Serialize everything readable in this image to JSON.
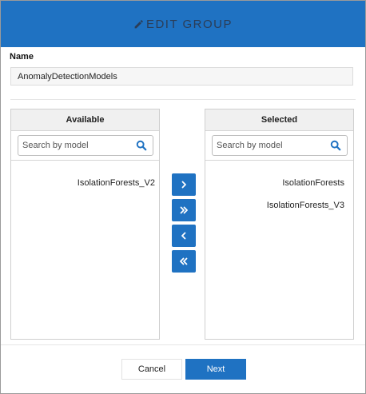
{
  "header": {
    "title": "EDIT GROUP",
    "icon": "pencil-icon",
    "background": "#1f72c2"
  },
  "name": {
    "label": "Name",
    "value": "AnomalyDetectionModels"
  },
  "available": {
    "title": "Available",
    "search_placeholder": "Search by model",
    "items": [
      "IsolationForests_V2"
    ]
  },
  "selected": {
    "title": "Selected",
    "search_placeholder": "Search by model",
    "items": [
      "IsolationForests",
      "IsolationForests_V3"
    ]
  },
  "transfer_buttons": [
    {
      "name": "move-selected-right",
      "icon": "chevron-right-icon"
    },
    {
      "name": "move-all-right",
      "icon": "double-chevron-right-icon"
    },
    {
      "name": "move-selected-left",
      "icon": "chevron-left-icon"
    },
    {
      "name": "move-all-left",
      "icon": "double-chevron-left-icon"
    }
  ],
  "footer": {
    "cancel_label": "Cancel",
    "next_label": "Next"
  },
  "colors": {
    "accent": "#1f72c2",
    "header_text": "#2b3d57"
  }
}
